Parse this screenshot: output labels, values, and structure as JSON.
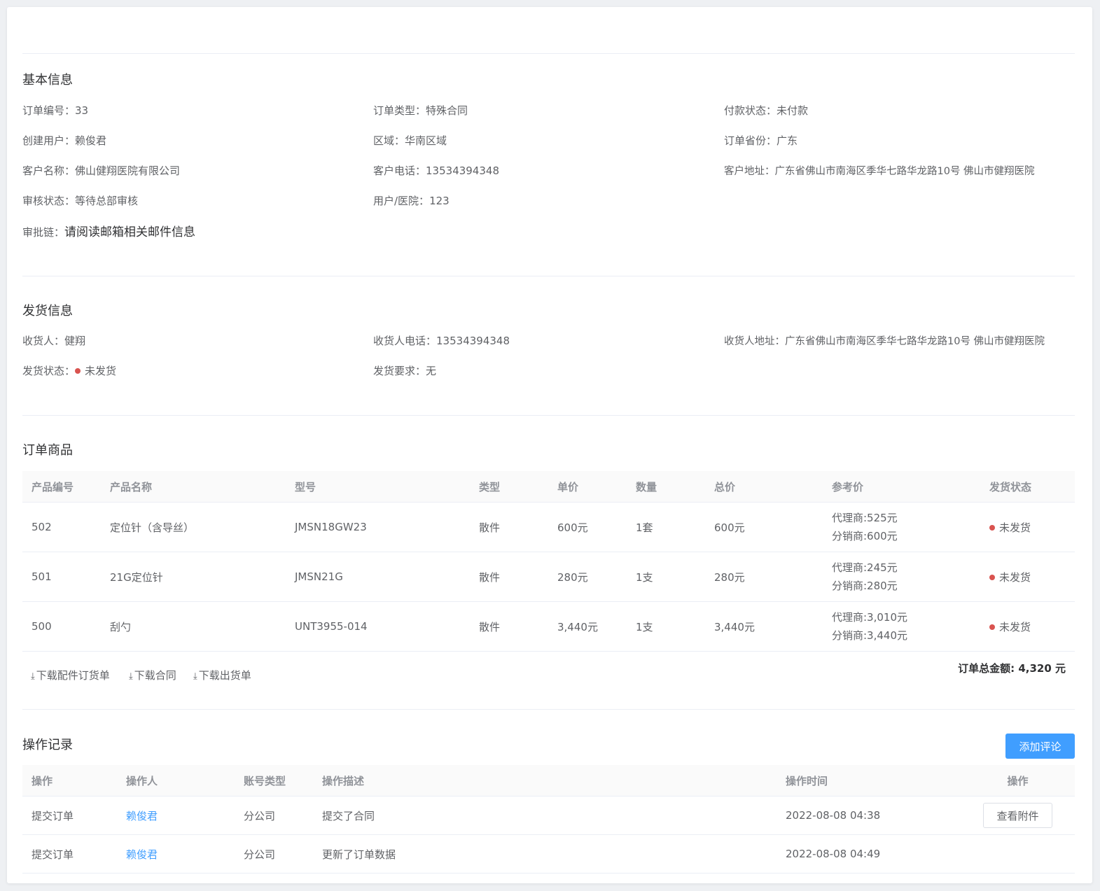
{
  "basic": {
    "title": "基本信息",
    "order_no": {
      "label": "订单编号：",
      "value": "33"
    },
    "order_type": {
      "label": "订单类型：",
      "value": "特殊合同"
    },
    "pay_status": {
      "label": "付款状态：",
      "value": "未付款"
    },
    "creator": {
      "label": "创建用户：",
      "value": "赖俊君"
    },
    "region": {
      "label": "区域：",
      "value": "华南区域"
    },
    "province": {
      "label": "订单省份：",
      "value": "广东"
    },
    "customer": {
      "label": "客户名称：",
      "value": "佛山健翔医院有限公司"
    },
    "phone": {
      "label": "客户电话：",
      "value": "13534394348"
    },
    "address": {
      "label": "客户地址：",
      "value": "广东省佛山市南海区季华七路华龙路10号 佛山市健翔医院"
    },
    "audit": {
      "label": "审核状态：",
      "value": "等待总部审核"
    },
    "user_hospital": {
      "label": "用户/医院：",
      "value": "123"
    },
    "approval_chain": {
      "label": "审批链：",
      "value": "请阅读邮箱相关邮件信息"
    }
  },
  "shipping": {
    "title": "发货信息",
    "receiver": {
      "label": "收货人：",
      "value": "健翔"
    },
    "receiver_phone": {
      "label": "收货人电话：",
      "value": "13534394348"
    },
    "receiver_addr": {
      "label": "收货人地址：",
      "value": "广东省佛山市南海区季华七路华龙路10号 佛山市健翔医院"
    },
    "ship_status": {
      "label": "发货状态：",
      "value": "未发货"
    },
    "ship_req": {
      "label": "发货要求：",
      "value": "无"
    }
  },
  "goods": {
    "title": "订单商品",
    "headers": [
      "产品编号",
      "产品名称",
      "型号",
      "类型",
      "单价",
      "数量",
      "总价",
      "参考价",
      "发货状态"
    ],
    "rows": [
      {
        "id": "502",
        "name": "定位针（含导丝）",
        "model": "JMSN18GW23",
        "type": "散件",
        "price": "600元",
        "qty": "1套",
        "total": "600元",
        "ref1": "代理商:525元",
        "ref2": "分销商:600元",
        "status": "未发货"
      },
      {
        "id": "501",
        "name": "21G定位针",
        "model": "JMSN21G",
        "type": "散件",
        "price": "280元",
        "qty": "1支",
        "total": "280元",
        "ref1": "代理商:245元",
        "ref2": "分销商:280元",
        "status": "未发货"
      },
      {
        "id": "500",
        "name": "刮勺",
        "model": "UNT3955-014",
        "type": "散件",
        "price": "3,440元",
        "qty": "1支",
        "total": "3,440元",
        "ref1": "代理商:3,010元",
        "ref2": "分销商:3,440元",
        "status": "未发货"
      }
    ],
    "downloads": [
      "下载配件订货单",
      "下载合同",
      "下载出货单"
    ],
    "total_label": "订单总金额: 4,320 元"
  },
  "ops": {
    "title": "操作记录",
    "add_comment": "添加评论",
    "headers": [
      "操作",
      "操作人",
      "账号类型",
      "操作描述",
      "操作时间",
      "操作"
    ],
    "rows": [
      {
        "op": "提交订单",
        "user": "赖俊君",
        "acct": "分公司",
        "desc": "提交了合同",
        "time": "2022-08-08 04:38",
        "action": "查看附件"
      },
      {
        "op": "提交订单",
        "user": "赖俊君",
        "acct": "分公司",
        "desc": "更新了订单数据",
        "time": "2022-08-08 04:49",
        "action": ""
      }
    ]
  },
  "colors": {
    "primary": "#409eff",
    "status_dot": "#d9534f"
  }
}
